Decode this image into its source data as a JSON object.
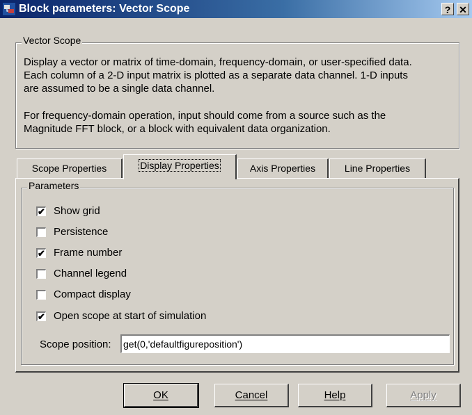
{
  "window": {
    "title": "Block parameters: Vector Scope",
    "help_glyph": "?",
    "close_glyph": "✕"
  },
  "description": {
    "group_title": "Vector Scope",
    "line1": "Display a vector or matrix of time-domain, frequency-domain, or user-specified data.",
    "line2": "Each column of a 2-D input matrix is plotted as a separate data channel.  1-D inputs",
    "line3": "are assumed to be a single data channel.",
    "line4": "For frequency-domain operation, input should come from a source such as the",
    "line5": "Magnitude FFT block, or a block with equivalent data organization."
  },
  "tabs": [
    {
      "label": "Scope Properties"
    },
    {
      "label": "Display Properties"
    },
    {
      "label": "Axis Properties"
    },
    {
      "label": "Line Properties"
    }
  ],
  "active_tab": "Display Properties",
  "parameters": {
    "group_title": "Parameters",
    "checkboxes": [
      {
        "label": "Show grid",
        "checked": true,
        "mark": "✔"
      },
      {
        "label": "Persistence",
        "checked": false,
        "mark": ""
      },
      {
        "label": "Frame number",
        "checked": true,
        "mark": "✔"
      },
      {
        "label": "Channel legend",
        "checked": false,
        "mark": ""
      },
      {
        "label": "Compact display",
        "checked": false,
        "mark": ""
      },
      {
        "label": "Open scope at start of simulation",
        "checked": true,
        "mark": "✔"
      }
    ],
    "scope_position_label": "Scope position:",
    "scope_position_value": "get(0,'defaultfigureposition')"
  },
  "buttons": {
    "ok": "OK",
    "cancel": "Cancel",
    "help": "Help",
    "apply": "Apply"
  }
}
